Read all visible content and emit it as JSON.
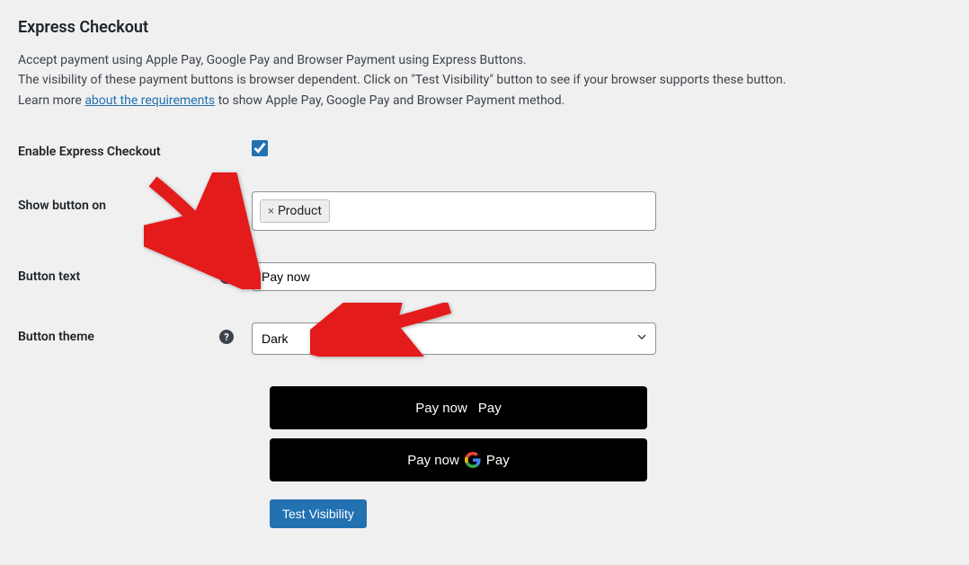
{
  "title": "Express Checkout",
  "description": {
    "line1": "Accept payment using Apple Pay, Google Pay and Browser Payment using Express Buttons.",
    "line2a": "The visibility of these payment buttons is browser dependent. Click on \"Test Visibility\" button to see if your browser supports these button.",
    "line3a": "Learn more ",
    "link": "about the requirements",
    "line3b": " to show Apple Pay, Google Pay and Browser Payment method."
  },
  "fields": {
    "enable": {
      "label": "Enable Express Checkout",
      "checked": true
    },
    "show_on": {
      "label": "Show button on",
      "tags": [
        {
          "label": "Product"
        }
      ]
    },
    "button_text": {
      "label": "Button text",
      "value": "Pay now"
    },
    "button_theme": {
      "label": "Button theme",
      "value": "Dark"
    }
  },
  "preview": {
    "apple_prefix": "Pay now",
    "apple_brand": "Pay",
    "google_prefix": "Pay now",
    "google_brand": "Pay"
  },
  "buttons": {
    "test_visibility": "Test Visibility"
  },
  "help_glyph": "?"
}
